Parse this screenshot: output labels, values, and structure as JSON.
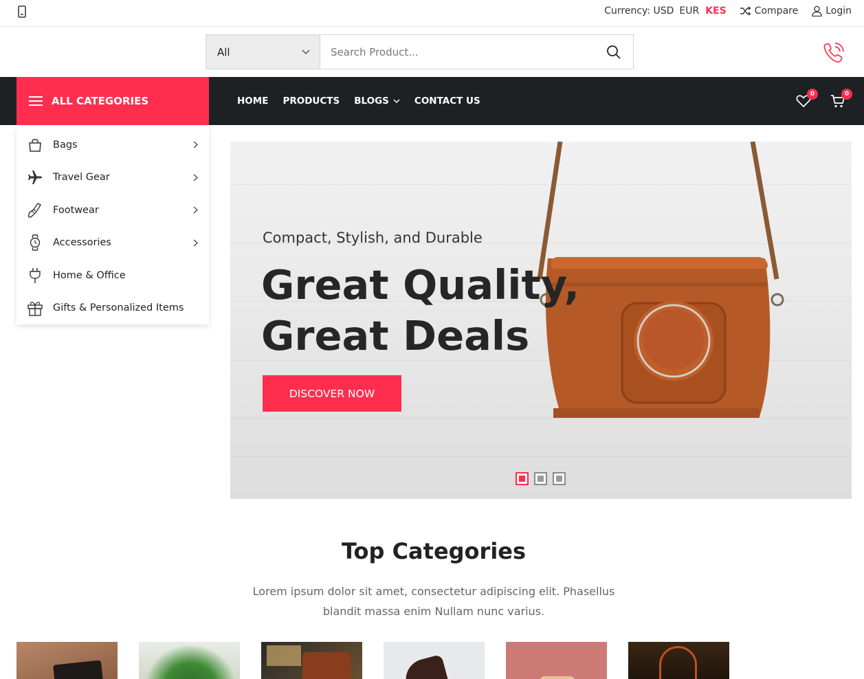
{
  "topbar": {
    "currency_label": "Currency: USD",
    "currency_options": [
      "EUR",
      "KES"
    ],
    "compare_label": "Compare",
    "login_label": "Login"
  },
  "search": {
    "category_value": "All",
    "placeholder": "Search Product..."
  },
  "nav": {
    "all_categories_label": "ALL CATEGORIES",
    "menu": [
      "HOME",
      "PRODUCTS",
      "BLOGS",
      "CONTACT US"
    ],
    "wishlist_count": "0",
    "cart_count": "0"
  },
  "categories": [
    {
      "label": "Bags",
      "icon": "bag-icon",
      "has_submenu": true
    },
    {
      "label": "Travel Gear",
      "icon": "airplane-icon",
      "has_submenu": true
    },
    {
      "label": "Footwear",
      "icon": "shoe-icon",
      "has_submenu": true
    },
    {
      "label": "Accessories",
      "icon": "watch-icon",
      "has_submenu": true
    },
    {
      "label": "Home & Office",
      "icon": "plug-icon",
      "has_submenu": false
    },
    {
      "label": "Gifts & Personalized Items",
      "icon": "gift-icon",
      "has_submenu": false
    }
  ],
  "hero": {
    "subtitle": "Compact, Stylish, and Durable",
    "title_line1": "Great Quality,",
    "title_line2": "Great Deals",
    "button_label": "DISCOVER NOW",
    "slide_count": 3,
    "active_slide": 1
  },
  "top_categories": {
    "title": "Top Categories",
    "description": "Lorem ipsum dolor sit amet, consectetur adipiscing elit. Phasellus blandit massa enim Nullam nunc varius."
  },
  "colors": {
    "accent": "#ff2e4f",
    "nav_bg": "#1e2124"
  }
}
